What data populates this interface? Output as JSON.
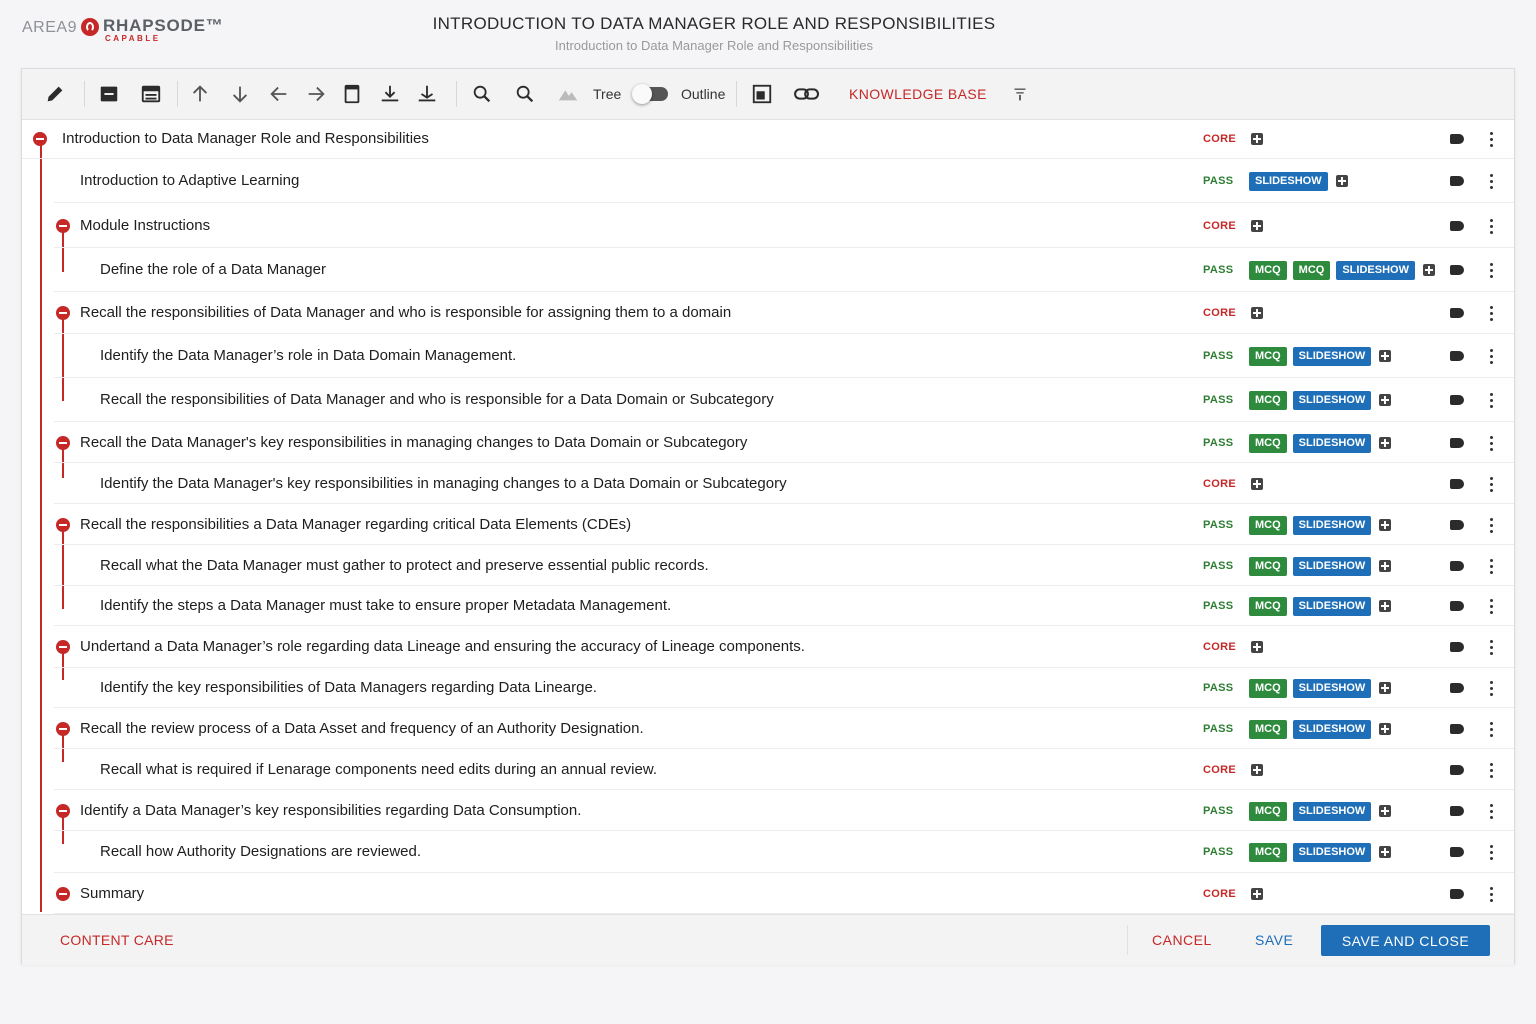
{
  "header": {
    "logo_area9": "AREA9",
    "logo_rhapsode": "RHAPSODE™",
    "logo_capable": "CAPABLE",
    "title": "INTRODUCTION TO DATA MANAGER ROLE AND RESPONSIBILITIES",
    "subtitle": "Introduction to Data Manager Role and Responsibilities"
  },
  "toolbar": {
    "tree_label": "Tree",
    "outline_label": "Outline",
    "knowledge_base_label": "KNOWLEDGE BASE"
  },
  "tree": {
    "rows": [
      {
        "label": "Introduction to Data Manager Role and Responsibilities",
        "status": "CORE",
        "tags": []
      },
      {
        "label": "Introduction to Adaptive Learning",
        "status": "PASS",
        "tags": [
          "SLIDESHOW"
        ]
      },
      {
        "label": "Module Instructions",
        "status": "CORE",
        "tags": []
      },
      {
        "label": "Define the role of a Data Manager",
        "status": "PASS",
        "tags": [
          "MCQ",
          "MCQ",
          "SLIDESHOW"
        ]
      },
      {
        "label": "Recall the responsibilities of Data Manager and who is responsible for assigning them to a domain",
        "status": "CORE",
        "tags": []
      },
      {
        "label": "Identify the Data Manager’s role in Data Domain Management.",
        "status": "PASS",
        "tags": [
          "MCQ",
          "SLIDESHOW"
        ]
      },
      {
        "label": "Recall the responsibilities of Data Manager and who is responsible for a Data Domain or Subcategory",
        "status": "PASS",
        "tags": [
          "MCQ",
          "SLIDESHOW"
        ]
      },
      {
        "label": "Recall the Data Manager's key responsibilities in managing changes to Data Domain or Subcategory",
        "status": "PASS",
        "tags": [
          "MCQ",
          "SLIDESHOW"
        ]
      },
      {
        "label": "Identify the Data Manager's key responsibilities in managing changes to a Data Domain or Subcategory",
        "status": "CORE",
        "tags": []
      },
      {
        "label": "Recall the responsibilities a Data Manager regarding critical Data Elements (CDEs)",
        "status": "PASS",
        "tags": [
          "MCQ",
          "SLIDESHOW"
        ]
      },
      {
        "label": "Recall what the Data Manager must gather to protect and preserve essential public records.",
        "status": "PASS",
        "tags": [
          "MCQ",
          "SLIDESHOW"
        ]
      },
      {
        "label": "Identify the steps a Data Manager must take to ensure proper Metadata Management.",
        "status": "PASS",
        "tags": [
          "MCQ",
          "SLIDESHOW"
        ]
      },
      {
        "label": "Undertand a Data Manager’s role regarding data Lineage and ensuring the accuracy of Lineage components.",
        "status": "CORE",
        "tags": []
      },
      {
        "label": "Identify the key responsibilities of Data Managers regarding Data Linearge.",
        "status": "PASS",
        "tags": [
          "MCQ",
          "SLIDESHOW"
        ]
      },
      {
        "label": "Recall the review process of a Data Asset and frequency of an Authority Designation.",
        "status": "PASS",
        "tags": [
          "MCQ",
          "SLIDESHOW"
        ]
      },
      {
        "label": "Recall what is  required if Lenarage components need edits during an annual review.",
        "status": "CORE",
        "tags": []
      },
      {
        "label": "Identify a Data Manager’s key responsibilities regarding Data Consumption.",
        "status": "PASS",
        "tags": [
          "MCQ",
          "SLIDESHOW"
        ]
      },
      {
        "label": "Recall how Authority Designations are reviewed.",
        "status": "PASS",
        "tags": [
          "MCQ",
          "SLIDESHOW"
        ]
      },
      {
        "label": "Summary",
        "status": "CORE",
        "tags": []
      }
    ]
  },
  "footer": {
    "content_care": "CONTENT CARE",
    "cancel": "CANCEL",
    "save": "SAVE",
    "save_and_close": "SAVE AND CLOSE"
  },
  "colors": {
    "accent_red": "#c62828",
    "primary_blue": "#1e6fb8",
    "mcq_green": "#2e8b3d",
    "pass_green": "#2e7d32"
  },
  "icons": [
    "edit-pencil-icon",
    "collapse-all-icon",
    "expand-all-icon",
    "arrow-up-icon",
    "arrow-down-icon",
    "arrow-left-icon",
    "arrow-right-icon",
    "page-icon",
    "import-icon",
    "export-icon",
    "search-icon",
    "zoom-icon",
    "mountain-icon",
    "preview-icon",
    "link-icon",
    "filter-icon"
  ]
}
